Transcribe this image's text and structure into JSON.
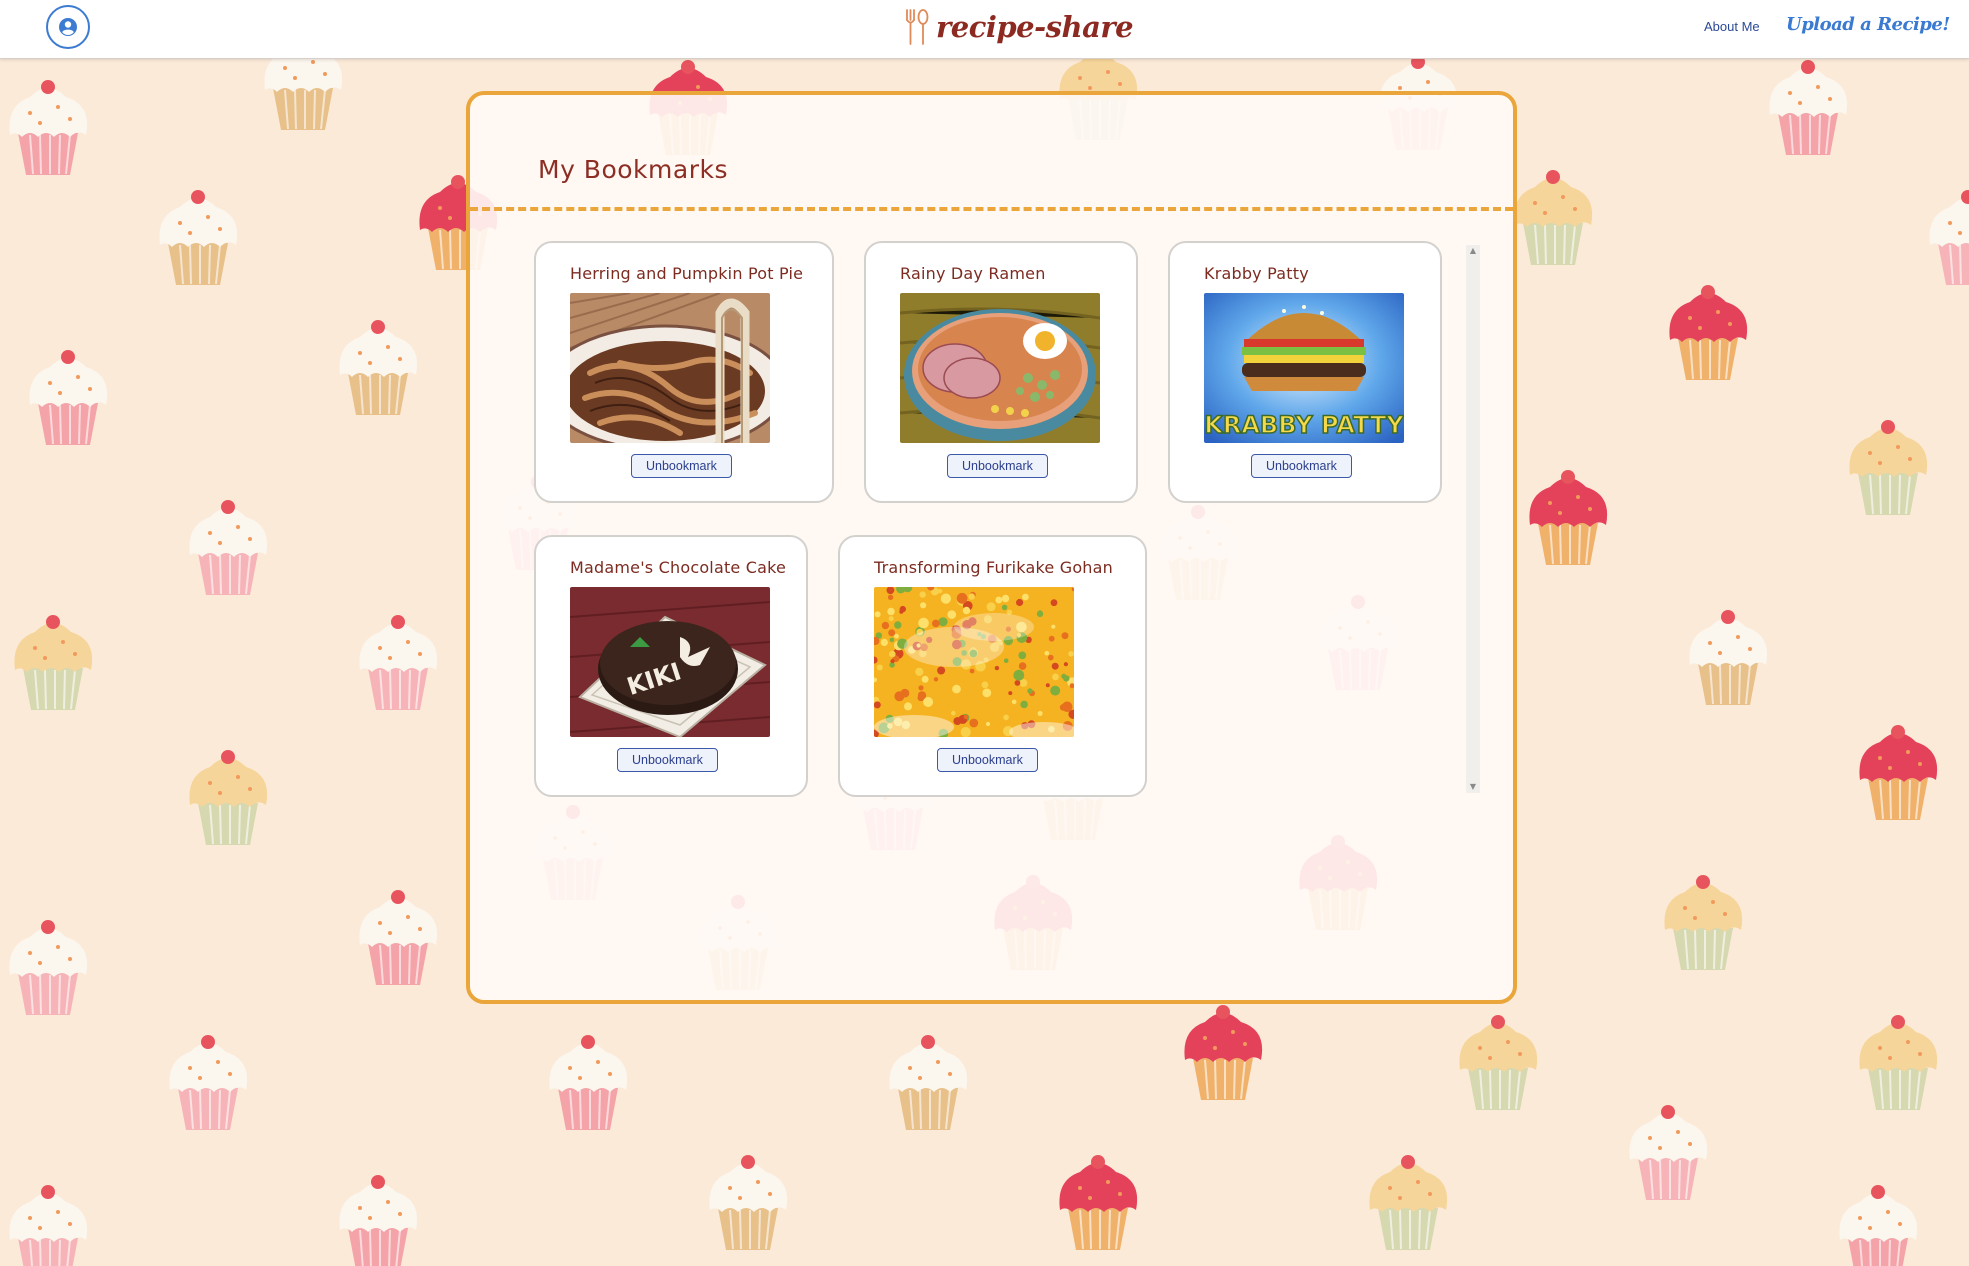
{
  "header": {
    "logo_text": "recipe-share",
    "nav": {
      "about": "About Me",
      "upload": "Upload a Recipe!"
    },
    "avatar_icon": "user-circle-icon",
    "logo_icon": "fork-spoon-icon"
  },
  "page": {
    "title": "My Bookmarks"
  },
  "bookmarks": [
    {
      "title": "Herring and Pumpkin Pot Pie",
      "button": "Unbookmark"
    },
    {
      "title": "Rainy Day Ramen",
      "button": "Unbookmark"
    },
    {
      "title": "Krabby Patty",
      "button": "Unbookmark"
    },
    {
      "title": "Madame's Chocolate Cake",
      "button": "Unbookmark"
    },
    {
      "title": "Transforming Furikake Gohan",
      "button": "Unbookmark"
    }
  ],
  "image_texts": {
    "krabby_patty": "KRABBY PATTY",
    "chocolate_cake": "KIKI"
  },
  "colors": {
    "accent_orange": "#eaa53b",
    "brand_red": "#8c2a22",
    "link_blue": "#3a7ad0",
    "background": "#fcead8"
  }
}
